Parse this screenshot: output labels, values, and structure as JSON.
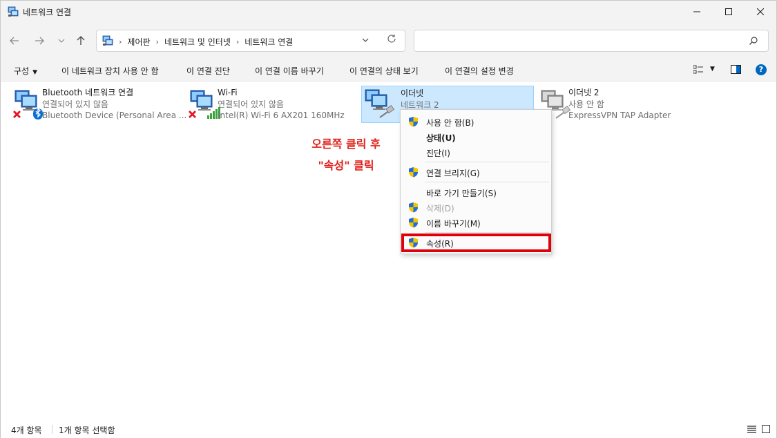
{
  "window": {
    "title": "네트워크 연결"
  },
  "nav": {
    "breadcrumbs": [
      "제어판",
      "네트워크 및 인터넷",
      "네트워크 연결"
    ]
  },
  "search": {
    "placeholder": ""
  },
  "commands": {
    "organize": "구성",
    "disable": "이 네트워크 장치 사용 안 함",
    "diagnose": "이 연결 진단",
    "rename": "이 연결 이름 바꾸기",
    "status": "이 연결의 상태 보기",
    "settings": "이 연결의 설정 변경"
  },
  "items": [
    {
      "name": "Bluetooth 네트워크 연결",
      "status": "연결되어 있지 않음",
      "device": "Bluetooth Device (Personal Area ...",
      "icon": "bluetooth-network-icon"
    },
    {
      "name": "Wi-Fi",
      "status": "연결되어 있지 않음",
      "device": "Intel(R) Wi-Fi 6 AX201 160MHz",
      "icon": "wifi-network-icon"
    },
    {
      "name": "이더넷",
      "status": "네트워크 2",
      "device": "",
      "icon": "ethernet-network-icon"
    },
    {
      "name": "이더넷 2",
      "status": "사용 안 함",
      "device": "ExpressVPN TAP Adapter",
      "icon": "ethernet-disabled-icon"
    }
  ],
  "annotation": {
    "line1": "오른쪽 클릭 후",
    "line2": "\"속성\" 클릭"
  },
  "context_menu": {
    "items": [
      {
        "label": "사용 안 함(B)"
      },
      {
        "label": "상태(U)"
      },
      {
        "label": "진단(I)"
      },
      {
        "label": "연결 브리지(G)"
      },
      {
        "label": "바로 가기 만들기(S)"
      },
      {
        "label": "삭제(D)"
      },
      {
        "label": "이름 바꾸기(M)"
      },
      {
        "label": "속성(R)"
      }
    ]
  },
  "statusbar": {
    "count": "4개 항목",
    "selected": "1개 항목 선택함"
  },
  "colors": {
    "accent": "#0067c0",
    "selection": "#cce8ff",
    "annotation": "#e0201b",
    "highlight_box": "#e0000a"
  }
}
